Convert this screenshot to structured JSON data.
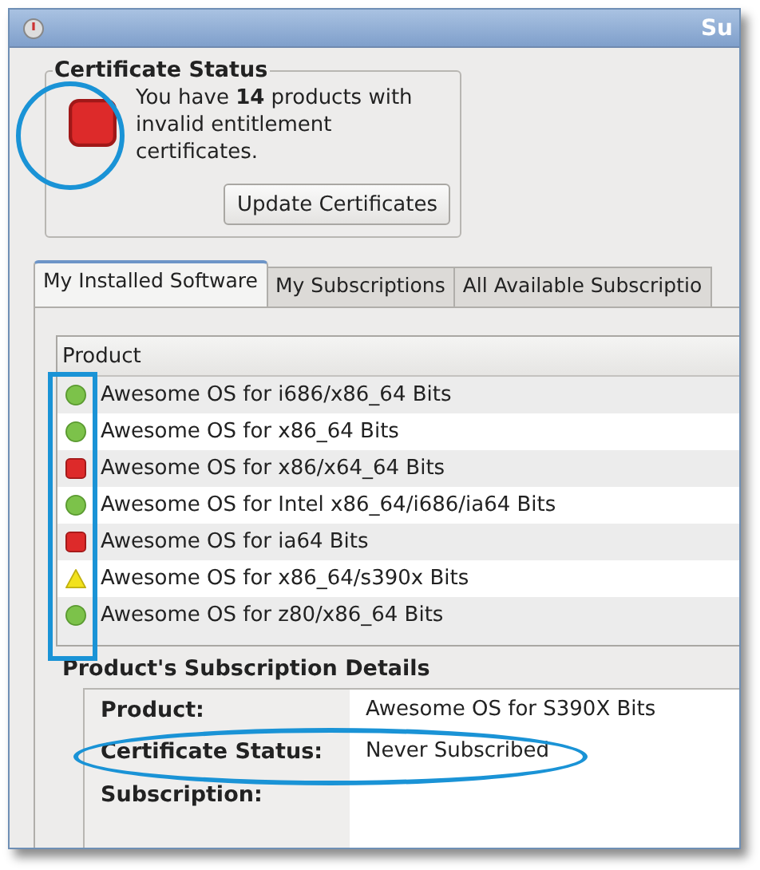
{
  "window": {
    "title": "Su"
  },
  "certificate_status": {
    "title": "Certificate Status",
    "kind": "invalid",
    "message": "You have **14** products with invalid entitlement certificates.",
    "button": "Update Certificates"
  },
  "tabs": [
    {
      "label": "My Installed Software",
      "selected": true
    },
    {
      "label": "My Subscriptions",
      "selected": false
    },
    {
      "label": "All Available Subscriptio",
      "selected": false
    }
  ],
  "table": {
    "columns": [
      "Product"
    ],
    "rows": [
      {
        "kind": "valid",
        "product": "Awesome OS for i686/x86_64 Bits"
      },
      {
        "kind": "valid",
        "product": "Awesome OS for x86_64 Bits"
      },
      {
        "kind": "invalid",
        "product": "Awesome OS for x86/x64_64 Bits"
      },
      {
        "kind": "valid",
        "product": "Awesome OS for Intel x86_64/i686/ia64 Bits"
      },
      {
        "kind": "invalid",
        "product": "Awesome OS for ia64 Bits"
      },
      {
        "kind": "partial",
        "product": "Awesome OS for x86_64/s390x Bits"
      },
      {
        "kind": "valid",
        "product": "Awesome OS for z80/x86_64 Bits"
      }
    ]
  },
  "details": {
    "title": "Product's Subscription Details",
    "fields": [
      {
        "label": "Product:",
        "value": "Awesome OS for S390X Bits"
      },
      {
        "label": "Certificate Status:",
        "value": "Never Subscribed"
      },
      {
        "label": "Subscription:"
      }
    ]
  }
}
